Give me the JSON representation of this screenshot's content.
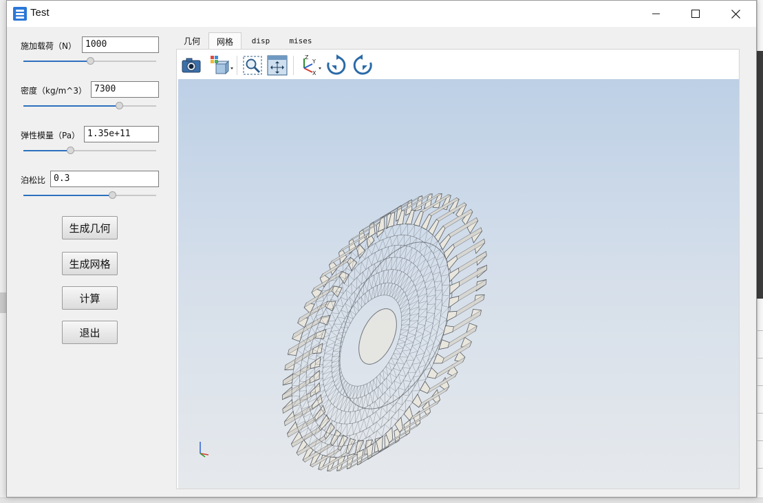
{
  "window": {
    "title": "Test",
    "controls": {
      "minimize": "minimize-icon",
      "maximize": "maximize-icon",
      "close": "close-icon"
    }
  },
  "params": [
    {
      "label": "施加载荷（N）",
      "value": "1000",
      "slider": 0.5
    },
    {
      "label": "密度（kg/m^3）",
      "value": "7300",
      "slider": 0.72
    },
    {
      "label": "弹性模量（Pa）",
      "value": "1.35e+11",
      "slider": 0.35
    },
    {
      "label": "泊松比",
      "value": "0.3",
      "slider": 0.67
    }
  ],
  "actions": {
    "generate_geometry": "生成几何",
    "generate_mesh": "生成网格",
    "compute": "计算",
    "exit": "退出"
  },
  "tabs": [
    {
      "label": "几何",
      "active": false
    },
    {
      "label": "网格",
      "active": true
    },
    {
      "label": "disp",
      "active": false
    },
    {
      "label": "mises",
      "active": false
    }
  ],
  "toolbar": {
    "icons": [
      "camera-icon",
      "view-mode-dropdown-icon",
      "zoom-window-icon",
      "fit-all-icon",
      "axes-orientation-dropdown-icon",
      "rotate-clockwise-icon",
      "rotate-counterclockwise-icon"
    ]
  },
  "viewport": {
    "content": "gear-mesh-model",
    "triad": "axis-triad-icon",
    "colors": {
      "top": "#bdd0e6",
      "bottom": "#e6e9ec",
      "mesh": "#555a60",
      "tooth_face": "#e9e6de"
    }
  },
  "colors": {
    "accent": "#2c6fbe",
    "app_icon": "#2a78d8"
  }
}
